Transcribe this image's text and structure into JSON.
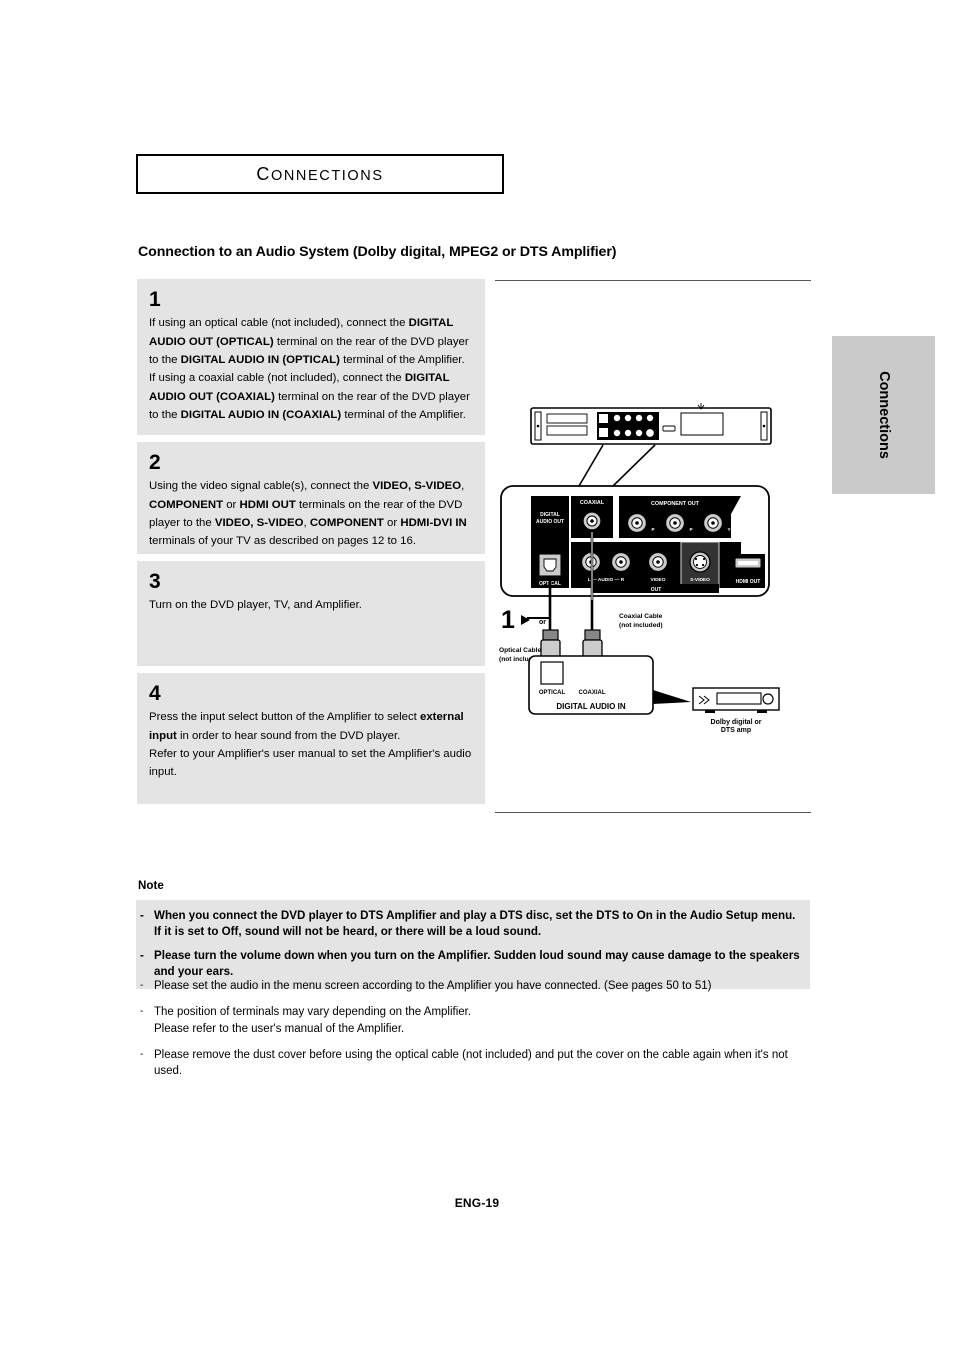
{
  "chapter": {
    "title_first": "C",
    "title_rest": "ONNECTIONS",
    "title_full": "CONNECTIONS"
  },
  "section": {
    "heading": "Connection to an Audio System (Dolby digital, MPEG2 or DTS Amplifier)"
  },
  "steps": [
    {
      "number": "1",
      "runs": [
        {
          "text": "If using an optical cable (not included), connect the ",
          "bold": false
        },
        {
          "text": "DIGITAL AUDIO OUT (OPTICAL)",
          "bold": true
        },
        {
          "text": " terminal on the rear of the DVD player to the ",
          "bold": false
        },
        {
          "text": "DIGITAL AUDIO IN (OPTICAL)",
          "bold": true
        },
        {
          "text": " terminal of the Amplifier. If using a coaxial cable (not included), connect the ",
          "bold": false
        },
        {
          "text": "DIGITAL AUDIO OUT (COAXIAL)",
          "bold": true
        },
        {
          "text": " terminal on the rear of the DVD player to the ",
          "bold": false
        },
        {
          "text": "DIGITAL AUDIO IN (COAXIAL)",
          "bold": true
        },
        {
          "text": " terminal of the Amplifier.",
          "bold": false
        }
      ]
    },
    {
      "number": "2",
      "runs": [
        {
          "text": "Using the video signal cable(s), connect the ",
          "bold": false
        },
        {
          "text": "VIDEO, S-VIDEO",
          "bold": true
        },
        {
          "text": ", ",
          "bold": false
        },
        {
          "text": "COMPONENT",
          "bold": true
        },
        {
          "text": " or ",
          "bold": false
        },
        {
          "text": "HDMI OUT",
          "bold": true
        },
        {
          "text": " terminals on the rear of the DVD player to the ",
          "bold": false
        },
        {
          "text": "VIDEO, S-VIDEO",
          "bold": true
        },
        {
          "text": ", ",
          "bold": false
        },
        {
          "text": "COMPONENT",
          "bold": true
        },
        {
          "text": " or ",
          "bold": false
        },
        {
          "text": "HDMI-DVI IN",
          "bold": true
        },
        {
          "text": " terminals of your TV as described on pages 12 to 16.",
          "bold": false
        }
      ]
    },
    {
      "number": "3",
      "runs": [
        {
          "text": "Turn on the DVD player, TV, and Amplifier.",
          "bold": false
        }
      ]
    },
    {
      "number": "4",
      "runs": [
        {
          "text": "Press the input select button of the Amplifier to select ",
          "bold": false
        },
        {
          "text": "external input",
          "bold": true
        },
        {
          "text": " in order to hear sound from the DVD player.",
          "bold": false
        },
        {
          "text": "\nRefer to your Amplifier's user manual to set the Amplifier's audio input.",
          "bold": false
        }
      ]
    }
  ],
  "diagram": {
    "panel_labels": {
      "digital_audio_out": "DIGITAL AUDIO OUT",
      "coaxial": "COAXIAL",
      "optical": "OPTICAL",
      "component_out": "COMPONENT OUT",
      "audio": "AUDIO",
      "audio_left": "L",
      "audio_right": "R",
      "video": "VIDEO",
      "s_video": "S-VIDEO",
      "hdmi_out": "HDMI OUT",
      "out": "OUT"
    },
    "callouts": {
      "step_marker": "1",
      "step_arrow": "▶",
      "or": "or",
      "optical_cable": "Optical Cable",
      "optical_cable_note": "(not included)",
      "coaxial_cable": "Coaxial Cable",
      "coaxial_cable_note": "(not included)",
      "amp_optical": "OPTICAL",
      "amp_coaxial": "COAXIAL",
      "digital_audio_in": "DIGITAL AUDIO IN",
      "amp_name_line1": "Dolby digital or",
      "amp_name_line2": "DTS amp"
    }
  },
  "side_tab": {
    "label": "Connections"
  },
  "note": {
    "label": "Note",
    "bold_items": [
      {
        "dash": "-",
        "text": "When you connect the DVD player to DTS Amplifier and play a DTS disc, set the DTS to On in the Audio Setup menu. If it is set to Off, sound will not be heard, or there will be a loud sound."
      },
      {
        "dash": "-",
        "text": "Please turn the volume down when you turn on the Amplifier. Sudden loud sound may cause damage to the speakers and your ears."
      }
    ],
    "plain_items": [
      {
        "dash": "-",
        "text": "Please set the audio in the menu screen according to the Amplifier you have connected. (See pages 50 to 51)"
      },
      {
        "dash": "-",
        "text": "The position of terminals may vary depending on the Amplifier.\nPlease refer to the user's manual of the Amplifier."
      },
      {
        "dash": "-",
        "text": "Please remove the dust cover before using the optical cable (not included) and put the cover on the cable again when it's not used."
      }
    ]
  },
  "footer": {
    "page_label": "ENG-19"
  },
  "colors": {
    "box_gray": "#e4e4e4",
    "tab_gray": "#cacaca",
    "rule": "#555555"
  }
}
